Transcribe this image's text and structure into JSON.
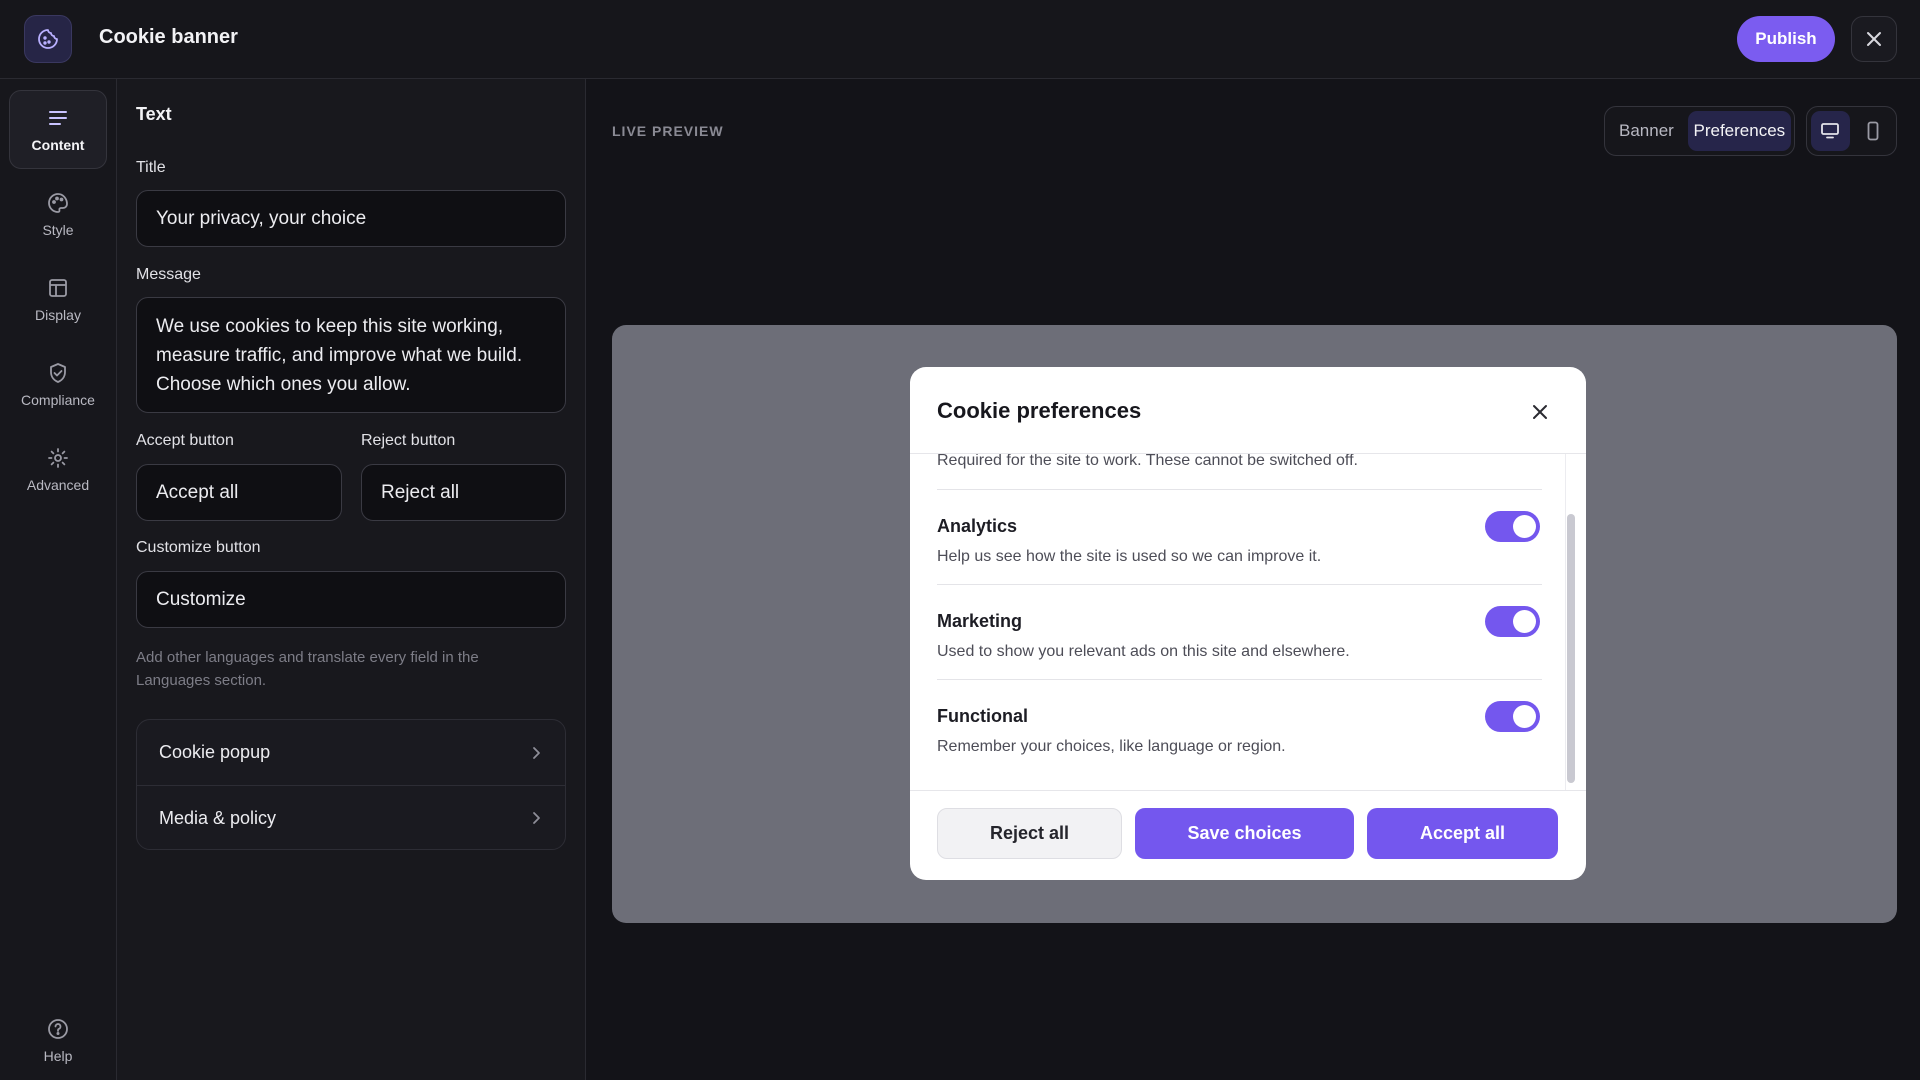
{
  "app": {
    "title": "Cookie banner",
    "publish_label": "Publish",
    "accent": "#7b5cf0"
  },
  "rail": {
    "items": [
      {
        "label": "Content",
        "icon": "lines-icon",
        "active": true
      },
      {
        "label": "Style",
        "icon": "palette-icon"
      },
      {
        "label": "Display",
        "icon": "layout-icon"
      },
      {
        "label": "Compliance",
        "icon": "shield-check-icon"
      },
      {
        "label": "Advanced",
        "icon": "gear-icon"
      }
    ],
    "help_label": "Help"
  },
  "panel": {
    "section_title": "Text",
    "title_label": "Title",
    "title_value": "Your privacy, your choice",
    "message_label": "Message",
    "message_value": "We use cookies to keep this site working, measure traffic, and improve what we build. Choose which ones you allow.",
    "accept_label": "Accept button",
    "accept_value": "Accept all",
    "reject_label": "Reject button",
    "reject_value": "Reject all",
    "customize_label": "Customize button",
    "customize_value": "Customize",
    "hint": "Add other languages and translate every field in the Languages section.",
    "nav": [
      {
        "label": "Cookie popup"
      },
      {
        "label": "Media & policy"
      }
    ]
  },
  "preview": {
    "label": "LIVE PREVIEW",
    "mode_tabs": [
      {
        "label": "Banner",
        "active": false
      },
      {
        "label": "Preferences",
        "active": true
      }
    ],
    "device_tabs": [
      {
        "icon": "desktop-icon",
        "active": true
      },
      {
        "icon": "mobile-icon",
        "active": false
      }
    ]
  },
  "modal": {
    "title": "Cookie preferences",
    "partial_desc": "Required for the site to work. These cannot be switched off.",
    "categories": [
      {
        "title": "Analytics",
        "desc": "Help us see how the site is used so we can improve it.",
        "enabled": true
      },
      {
        "title": "Marketing",
        "desc": "Used to show you relevant ads on this site and elsewhere.",
        "enabled": true
      },
      {
        "title": "Functional",
        "desc": "Remember your choices, like language or region.",
        "enabled": true
      }
    ],
    "buttons": {
      "reject": "Reject all",
      "save": "Save choices",
      "accept": "Accept all"
    }
  }
}
